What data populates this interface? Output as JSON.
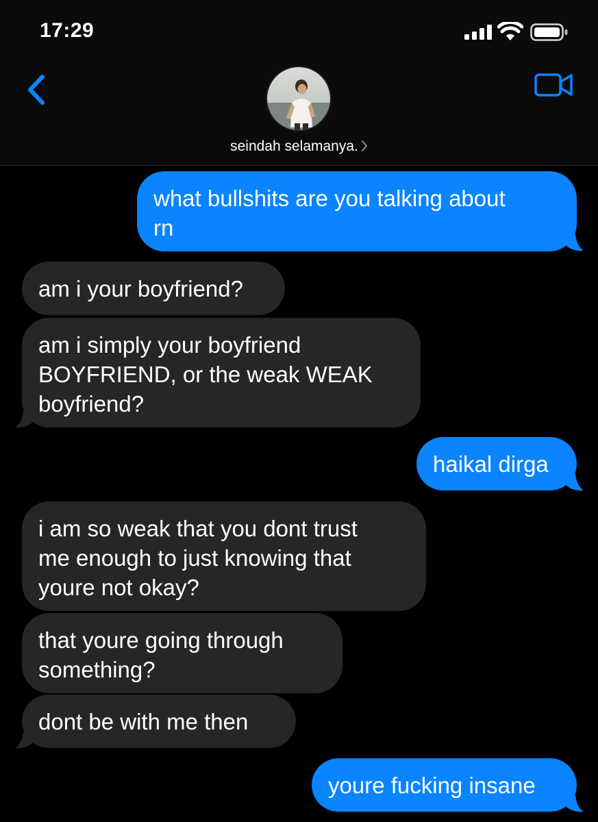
{
  "status_bar": {
    "time": "17:29",
    "signal_icon": "cellular-signal-icon",
    "wifi_icon": "wifi-icon",
    "battery_icon": "battery-icon"
  },
  "header": {
    "contact_name": "seindah selamanya.",
    "back_icon": "chevron-left-icon",
    "video_icon": "video-camera-icon",
    "accent_color": "#0a84ff"
  },
  "messages": [
    {
      "direction": "outgoing",
      "lines": [
        "what bullshits are you talking about",
        "rn"
      ]
    },
    {
      "direction": "incoming",
      "lines": [
        "am i your boyfriend?"
      ]
    },
    {
      "direction": "incoming",
      "lines": [
        "am i simply your boyfriend",
        "BOYFRIEND, or the weak WEAK",
        "boyfriend?"
      ]
    },
    {
      "direction": "outgoing",
      "lines": [
        "haikal dirga"
      ]
    },
    {
      "direction": "incoming",
      "lines": [
        "i am so weak that you dont trust",
        "me enough to just knowing that",
        "youre not okay?"
      ]
    },
    {
      "direction": "incoming",
      "lines": [
        "that youre going through",
        "something?"
      ]
    },
    {
      "direction": "incoming",
      "lines": [
        "dont be with me then"
      ]
    },
    {
      "direction": "outgoing",
      "lines": [
        "youre fucking insane"
      ]
    }
  ],
  "colors": {
    "outgoing_bubble": "#0a84ff",
    "incoming_bubble": "#262628",
    "background": "#000000"
  }
}
